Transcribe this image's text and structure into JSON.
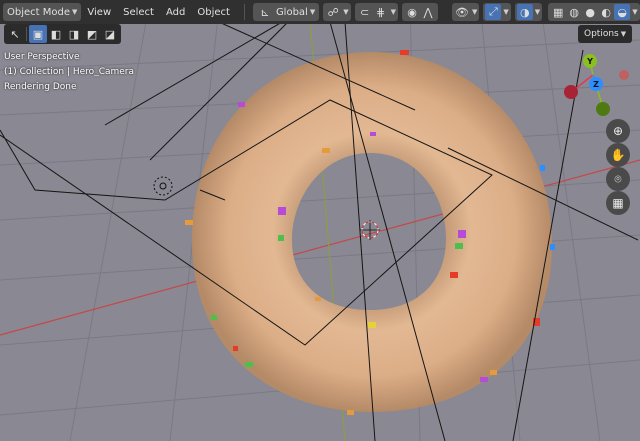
{
  "header": {
    "mode_label": "Object Mode",
    "menus": [
      "View",
      "Select",
      "Add",
      "Object"
    ],
    "transform_orientation": "Global"
  },
  "viewport": {
    "view_name": "User Perspective",
    "collection_info": "(1) Collection | Hero_Camera",
    "status": "Rendering Done",
    "options_label": "Options"
  },
  "gizmo": {
    "y_label": "Y",
    "z_label": "Z",
    "colors": {
      "x": "#e53855",
      "y": "#8bbe1f",
      "z": "#2c8fff"
    }
  },
  "colors": {
    "background": "#8a8892",
    "header": "#303030",
    "accent": "#4772b3",
    "donut": "#d9ae88",
    "x_axis": "#c54848",
    "y_axis": "#8aa13a"
  },
  "icons": {
    "select_tool": "cursor-icon",
    "nav": [
      "zoom-icon",
      "hand-pan-icon",
      "camera-icon",
      "grid-icon"
    ]
  }
}
